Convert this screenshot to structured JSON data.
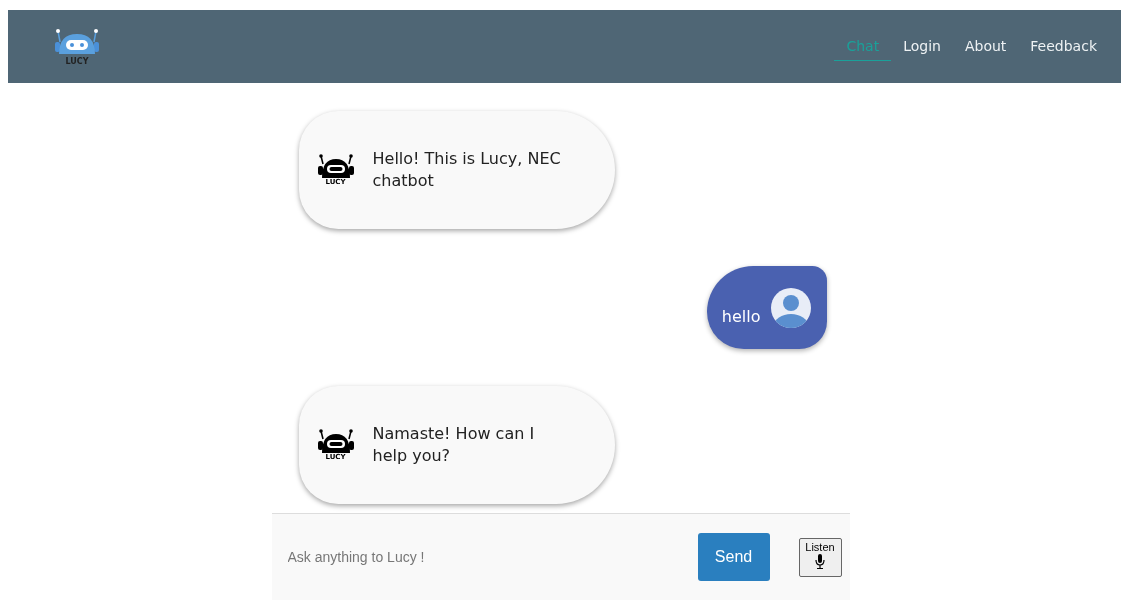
{
  "navbar": {
    "logo_text": "LUCY",
    "links": [
      {
        "label": "Chat",
        "selected": true
      },
      {
        "label": "Login",
        "selected": false
      },
      {
        "label": "About",
        "selected": false
      },
      {
        "label": "Feedback",
        "selected": false
      }
    ]
  },
  "messages": [
    {
      "kind": "bot",
      "avatar_text": "LUCY",
      "text": "Hello! This is Lucy, NEC chatbot"
    },
    {
      "kind": "user",
      "text": "hello"
    },
    {
      "kind": "bot",
      "avatar_text": "LUCY",
      "text": "Namaste! How can I help you?"
    }
  ],
  "composer": {
    "placeholder": "Ask anything to Lucy !",
    "send": "Send",
    "listen": "Listen"
  }
}
